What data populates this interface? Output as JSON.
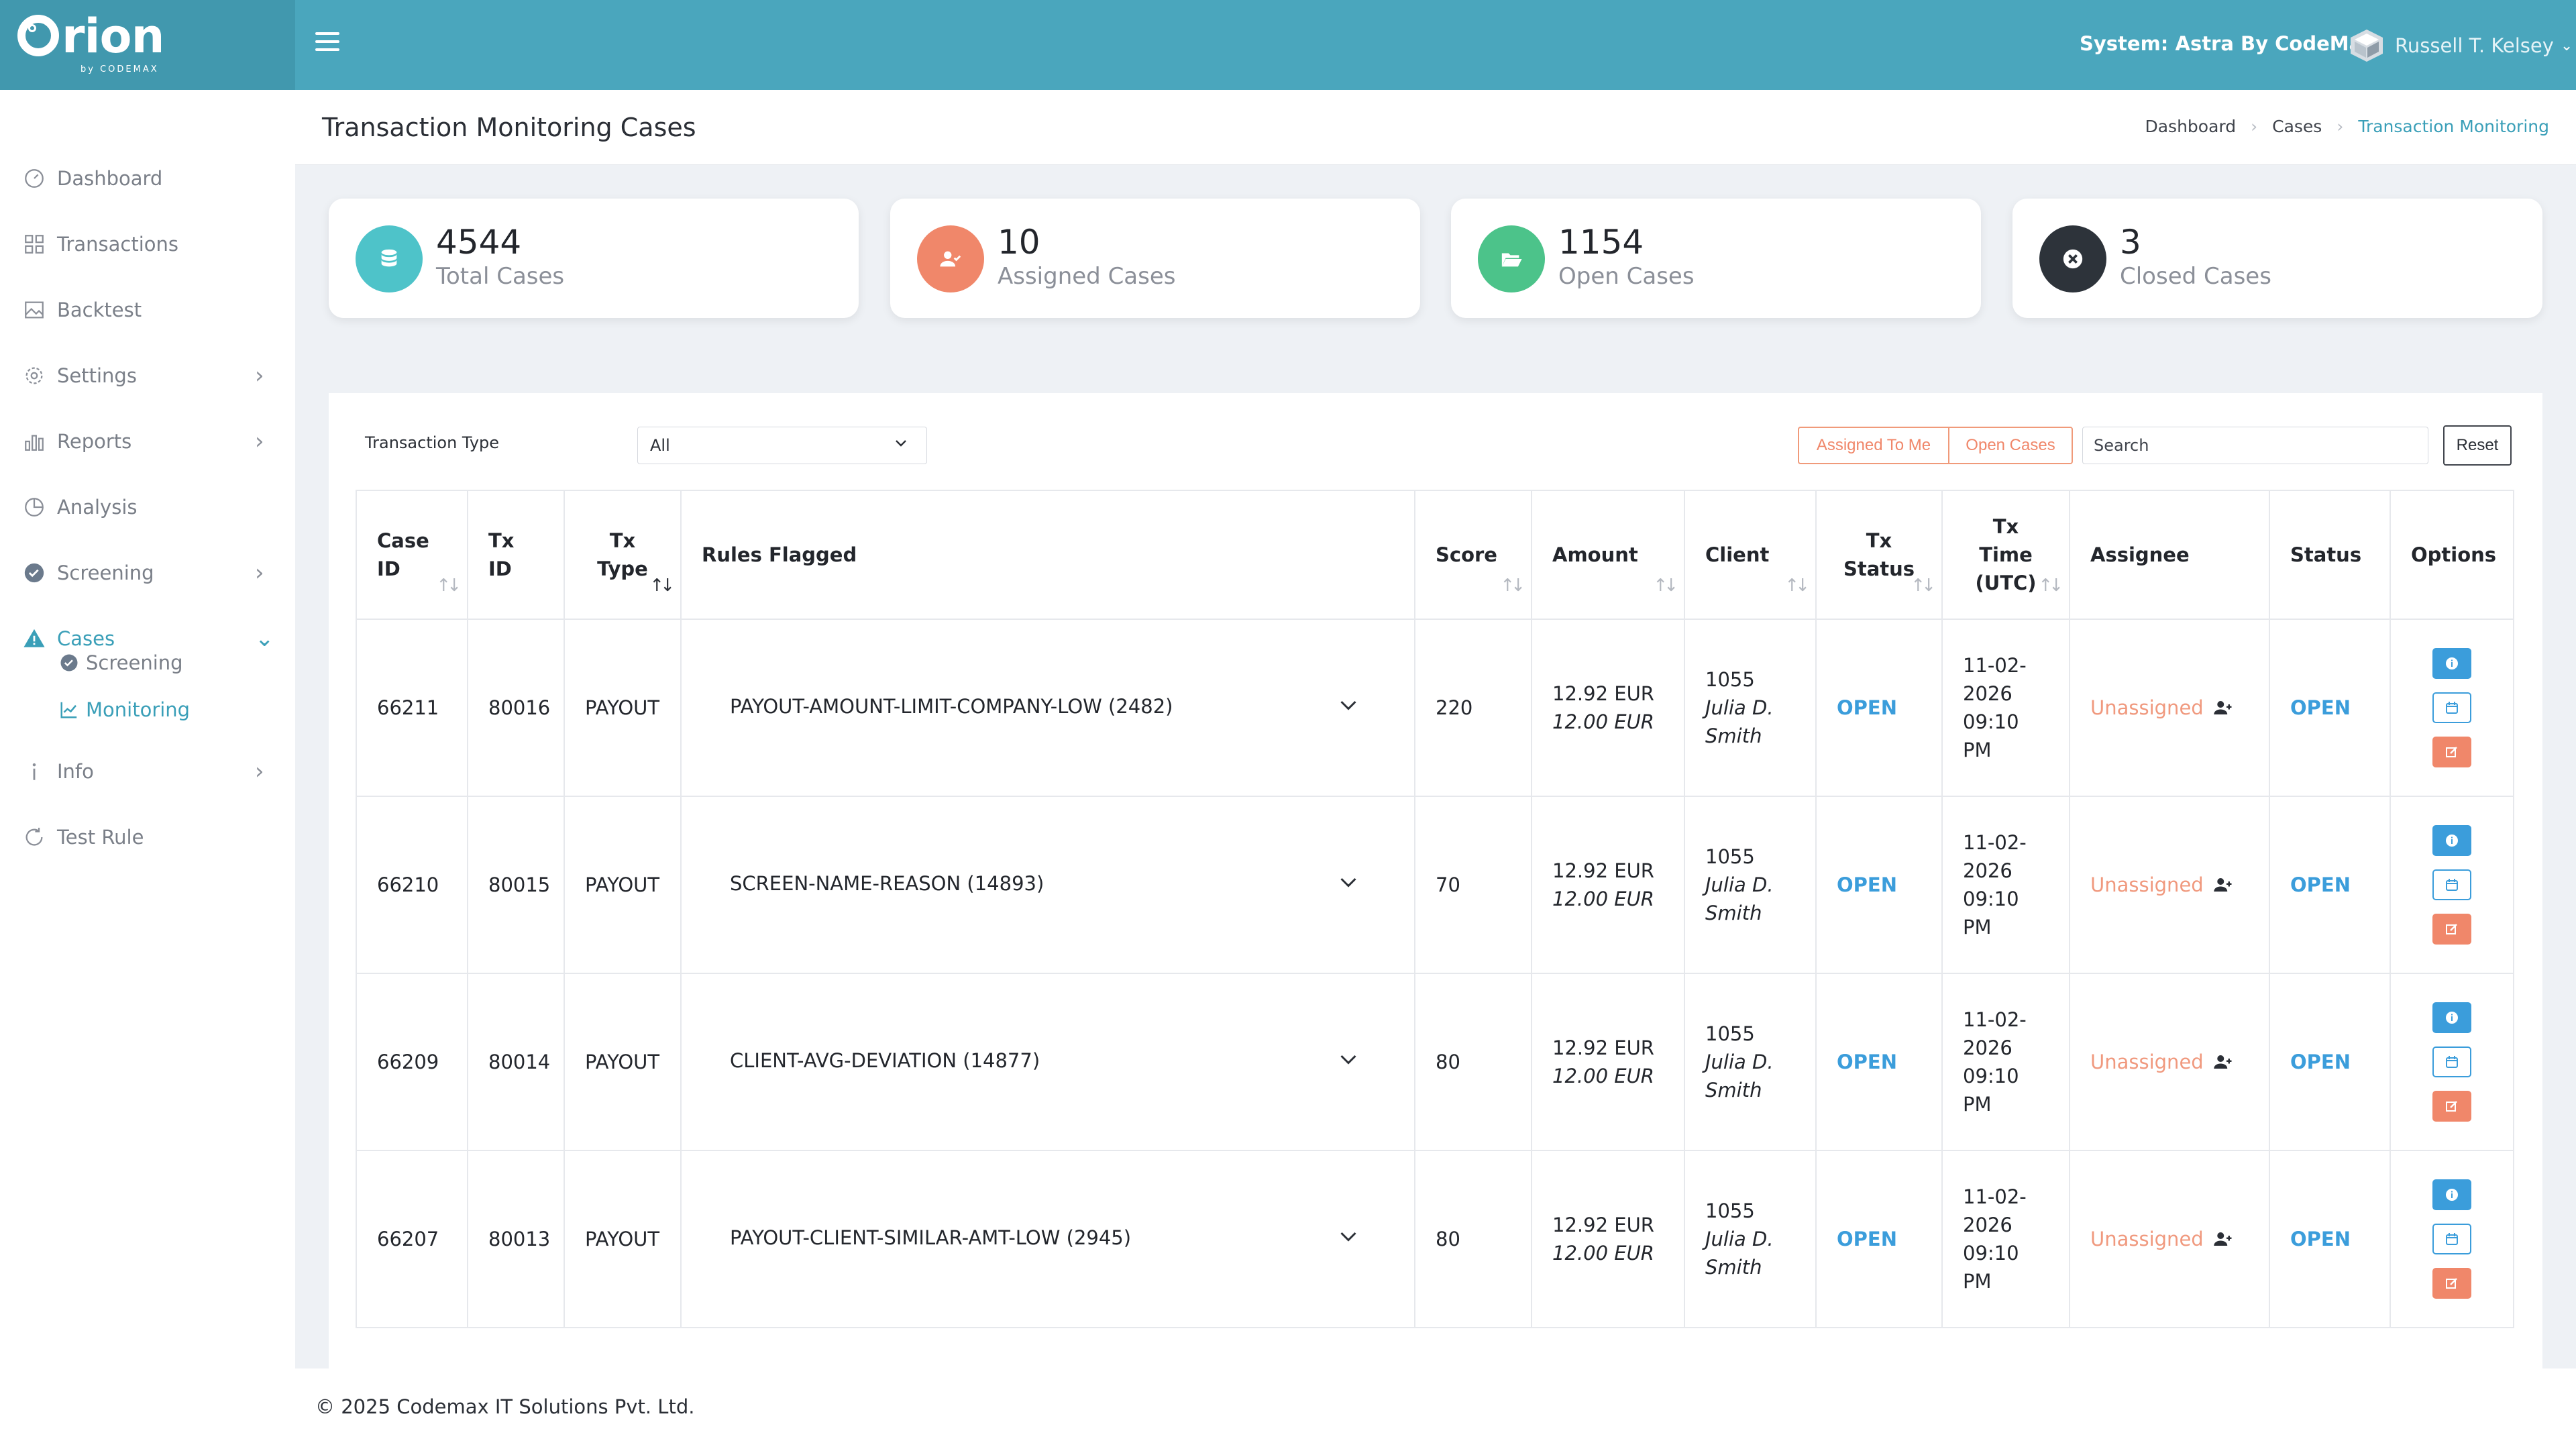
{
  "brand": {
    "name": "rion",
    "sub": "by CODEMAX"
  },
  "header": {
    "system": "System: Astra By CodeMax",
    "user": "Russell T. Kelsey"
  },
  "sidebar": {
    "items": [
      {
        "label": "Dashboard"
      },
      {
        "label": "Transactions"
      },
      {
        "label": "Backtest"
      },
      {
        "label": "Settings"
      },
      {
        "label": "Reports"
      },
      {
        "label": "Analysis"
      },
      {
        "label": "Screening"
      },
      {
        "label": "Cases"
      },
      {
        "label": "Info"
      },
      {
        "label": "Test Rule"
      }
    ],
    "subitems": [
      {
        "label": "Screening"
      },
      {
        "label": "Monitoring"
      }
    ]
  },
  "page": {
    "title": "Transaction Monitoring Cases",
    "breadcrumb": [
      "Dashboard",
      "Cases",
      "Transaction Monitoring"
    ]
  },
  "stats": [
    {
      "value": "4544",
      "label": "Total Cases",
      "color": "#4ec3c9"
    },
    {
      "value": "10",
      "label": "Assigned Cases",
      "color": "#f0876a"
    },
    {
      "value": "1154",
      "label": "Open Cases",
      "color": "#4cc38a"
    },
    {
      "value": "3",
      "label": "Closed Cases",
      "color": "#2d333a"
    }
  ],
  "filters": {
    "type_label": "Transaction Type",
    "type_value": "All",
    "assigned_btn": "Assigned To Me",
    "open_btn": "Open Cases",
    "search_placeholder": "Search",
    "reset": "Reset"
  },
  "table": {
    "headers": {
      "case_id": [
        "Case",
        "ID"
      ],
      "tx_id": "Tx ID",
      "tx_type": [
        "Tx",
        "Type"
      ],
      "rules": "Rules Flagged",
      "score": "Score",
      "amount": "Amount",
      "client": "Client",
      "tx_status": [
        "Tx",
        "Status"
      ],
      "tx_time": [
        "Tx",
        "Time",
        "(UTC)"
      ],
      "assignee": "Assignee",
      "status": "Status",
      "options": "Options"
    },
    "rows": [
      {
        "case_id": "66211",
        "tx_id": "80016",
        "tx_type": "PAYOUT",
        "rule": "PAYOUT-AMOUNT-LIMIT-COMPANY-LOW (2482)",
        "score": "220",
        "amount1": "12.92 EUR",
        "amount2": "12.00 EUR",
        "client_id": "1055",
        "client_first": "Julia D.",
        "client_last": "Smith",
        "tx_status": "OPEN",
        "time_date": "11-02-",
        "time_year": "2026",
        "time_clock": "09:10 PM",
        "assignee": "Unassigned",
        "status": "OPEN"
      },
      {
        "case_id": "66210",
        "tx_id": "80015",
        "tx_type": "PAYOUT",
        "rule": "SCREEN-NAME-REASON (14893)",
        "score": "70",
        "amount1": "12.92 EUR",
        "amount2": "12.00 EUR",
        "client_id": "1055",
        "client_first": "Julia D.",
        "client_last": "Smith",
        "tx_status": "OPEN",
        "time_date": "11-02-",
        "time_year": "2026",
        "time_clock": "09:10 PM",
        "assignee": "Unassigned",
        "status": "OPEN"
      },
      {
        "case_id": "66209",
        "tx_id": "80014",
        "tx_type": "PAYOUT",
        "rule": "CLIENT-AVG-DEVIATION (14877)",
        "score": "80",
        "amount1": "12.92 EUR",
        "amount2": "12.00 EUR",
        "client_id": "1055",
        "client_first": "Julia D.",
        "client_last": "Smith",
        "tx_status": "OPEN",
        "time_date": "11-02-",
        "time_year": "2026",
        "time_clock": "09:10 PM",
        "assignee": "Unassigned",
        "status": "OPEN"
      },
      {
        "case_id": "66207",
        "tx_id": "80013",
        "tx_type": "PAYOUT",
        "rule": "PAYOUT-CLIENT-SIMILAR-AMT-LOW (2945)",
        "score": "80",
        "amount1": "12.92 EUR",
        "amount2": "12.00 EUR",
        "client_id": "1055",
        "client_first": "Julia D.",
        "client_last": "Smith",
        "tx_status": "OPEN",
        "time_date": "11-02-",
        "time_year": "2026",
        "time_clock": "09:10 PM",
        "assignee": "Unassigned",
        "status": "OPEN"
      }
    ]
  },
  "footer": {
    "text": "© 2025 Codemax IT Solutions Pvt. Ltd."
  },
  "colors": {
    "topbar": "#4aa6bd",
    "accent": "#3a9fb8",
    "open": "#3b9ddb",
    "unassigned": "#f0997e"
  }
}
